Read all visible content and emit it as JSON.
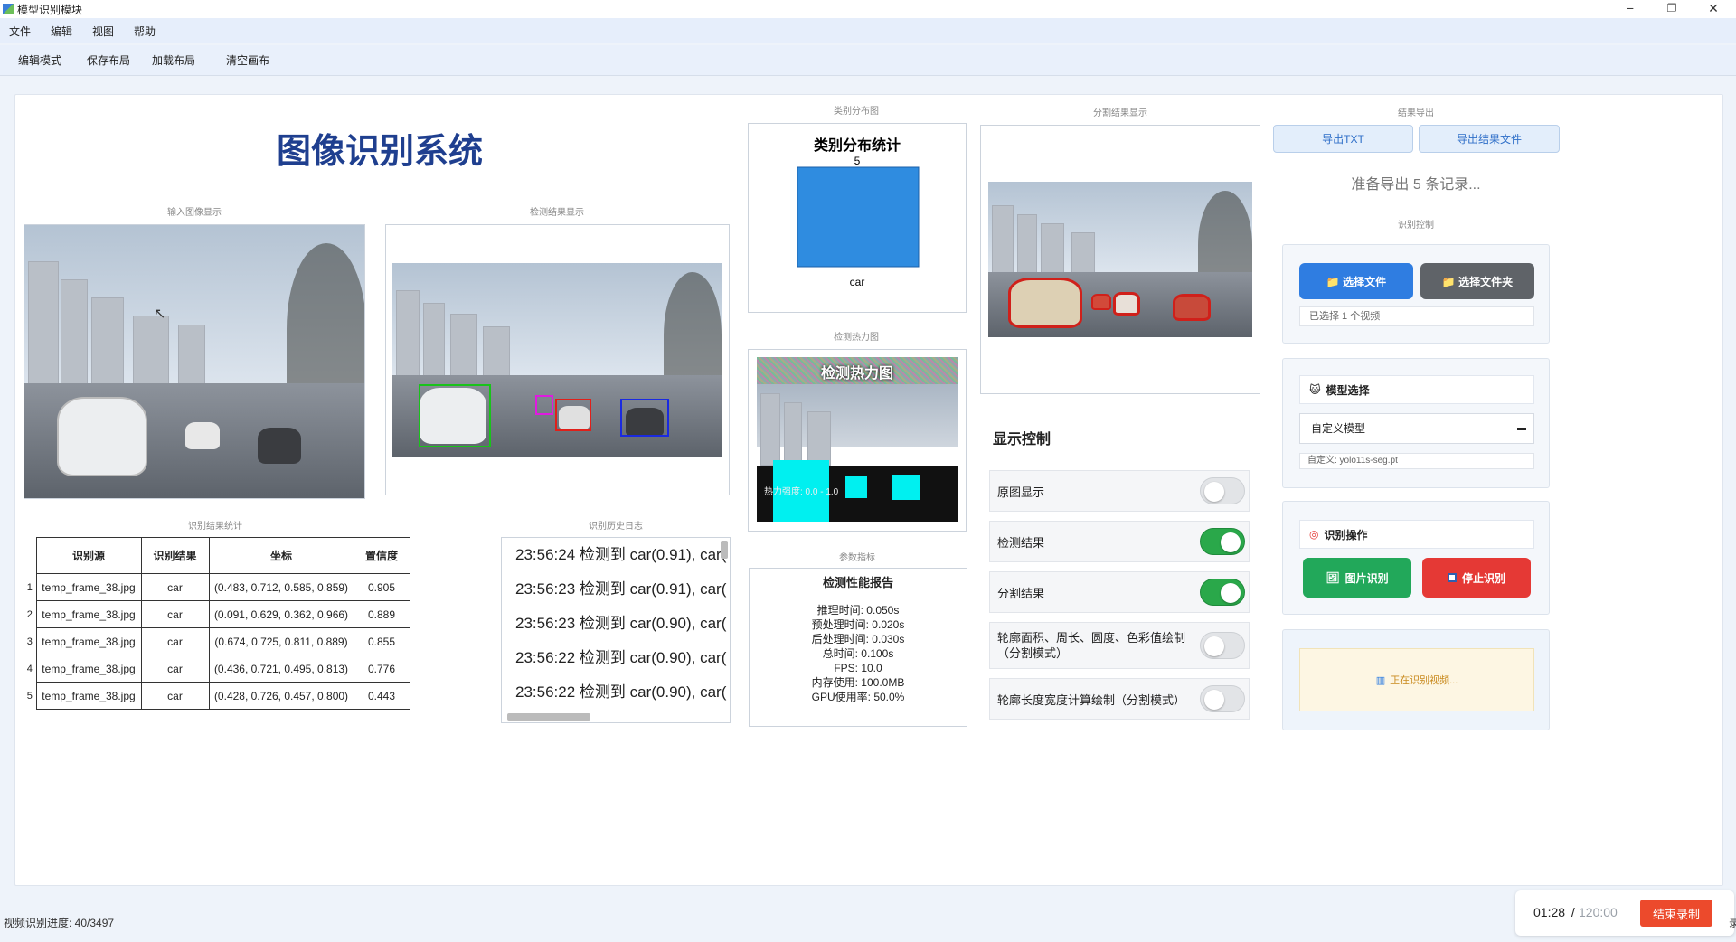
{
  "window": {
    "title": "模型识别模块",
    "minimize": "−",
    "restore": "❐",
    "close": "✕"
  },
  "menu": [
    "文件",
    "编辑",
    "视图",
    "帮助"
  ],
  "toolbar": [
    "编辑模式",
    "保存布局",
    "加载布局",
    "清空画布"
  ],
  "app_title": "图像识别系统",
  "captions": {
    "input_image": "输入图像显示",
    "detect_image": "检测结果显示",
    "class_dist": "类别分布图",
    "seg_image": "分割结果显示",
    "export": "结果导出",
    "heatmap": "检测热力图",
    "stats": "识别结果统计",
    "log": "识别历史日志",
    "perf": "参数指标",
    "recog_control": "识别控制"
  },
  "class_chart": {
    "title": "类别分布统计",
    "bar_value_label": "5",
    "category_label": "car"
  },
  "chart_data": {
    "type": "bar",
    "title": "类别分布统计",
    "categories": [
      "car"
    ],
    "values": [
      5
    ],
    "ylim": [
      0,
      5
    ],
    "color": "#2f8ce0"
  },
  "heatmap": {
    "title": "检测热力图",
    "intensity": "热力强度: 0.0 - 1.0"
  },
  "table": {
    "headers": [
      "识别源",
      "识别结果",
      "坐标",
      "置信度"
    ],
    "rows": [
      {
        "idx": "1",
        "source": "temp_frame_38.jpg",
        "result": "car",
        "coords": "(0.483, 0.712, 0.585, 0.859)",
        "conf": "0.905"
      },
      {
        "idx": "2",
        "source": "temp_frame_38.jpg",
        "result": "car",
        "coords": "(0.091, 0.629, 0.362, 0.966)",
        "conf": "0.889"
      },
      {
        "idx": "3",
        "source": "temp_frame_38.jpg",
        "result": "car",
        "coords": "(0.674, 0.725, 0.811, 0.889)",
        "conf": "0.855"
      },
      {
        "idx": "4",
        "source": "temp_frame_38.jpg",
        "result": "car",
        "coords": "(0.436, 0.721, 0.495, 0.813)",
        "conf": "0.776"
      },
      {
        "idx": "5",
        "source": "temp_frame_38.jpg",
        "result": "car",
        "coords": "(0.428, 0.726, 0.457, 0.800)",
        "conf": "0.443"
      }
    ]
  },
  "log": [
    "23:56:24 检测到 car(0.91), car(",
    "23:56:23 检测到 car(0.91), car(",
    "23:56:23 检测到 car(0.90), car(",
    "23:56:22 检测到 car(0.90), car(",
    "23:56:22 检测到 car(0.90), car("
  ],
  "perf": {
    "title": "检测性能报告",
    "lines": [
      "推理时间: 0.050s",
      "预处理时间: 0.020s",
      "后处理时间: 0.030s",
      "总时间: 0.100s",
      "FPS: 10.0",
      "内存使用: 100.0MB",
      "GPU使用率: 50.0%"
    ]
  },
  "display_control": {
    "title": "显示控制",
    "toggles": [
      {
        "label": "原图显示",
        "on": false
      },
      {
        "label": "检测结果",
        "on": true
      },
      {
        "label": "分割结果",
        "on": true
      },
      {
        "label": "轮廓面积、周长、圆度、色彩值绘制（分割模式）",
        "on": false
      },
      {
        "label": "轮廓长度宽度计算绘制（分割模式）",
        "on": false
      }
    ]
  },
  "export": {
    "txt_button": "导出TXT",
    "file_button": "导出结果文件",
    "status": "准备导出 5 条记录..."
  },
  "file_select": {
    "file_button": "📁 选择文件",
    "folder_button": "📁 选择文件夹",
    "selected": "已选择 1 个视频"
  },
  "model_select": {
    "header": "模型选择",
    "value": "自定义模型",
    "custom": "自定义: yolo11s-seg.pt"
  },
  "recog_ops": {
    "header": "识别操作",
    "image_button": "图片识别",
    "stop_button": "停止识别",
    "status": "正在识别视频..."
  },
  "statusbar": {
    "progress": "视频识别进度: 40/3497",
    "elapsed": "01:28",
    "separator": " / ",
    "total": "120:00",
    "end_record": "结束录制",
    "edge_char": "录"
  },
  "colors": {
    "accent": "#2f7de1",
    "green": "#22a85a",
    "red": "#e53935",
    "gray_btn": "#5f6368",
    "title_blue": "#1f3f8f"
  }
}
